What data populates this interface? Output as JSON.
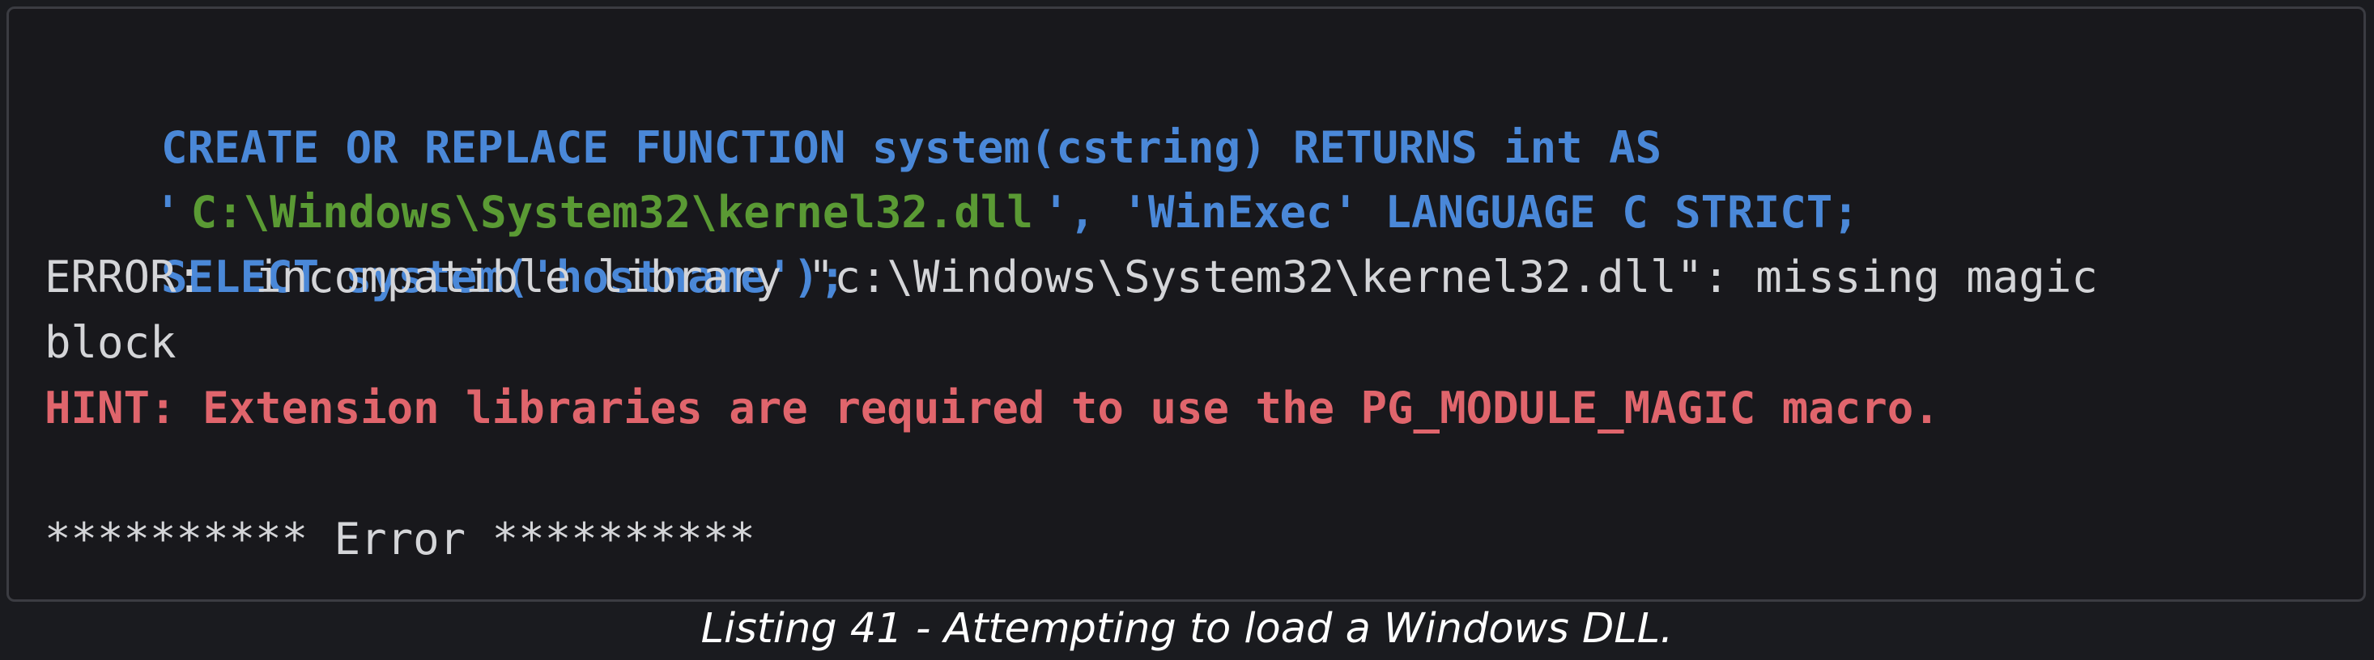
{
  "listing": {
    "sql": {
      "line1": "CREATE OR REPLACE FUNCTION system(cstring) RETURNS int AS",
      "line2_quote_open": "'",
      "line2_path": "C:\\Windows\\System32\\kernel32.dll",
      "line2_rest": "', 'WinExec' LANGUAGE C STRICT;",
      "line3": "SELECT system('hostname');"
    },
    "output": {
      "error_line1": "ERROR:  incompatible library \"c:\\Windows\\System32\\kernel32.dll\": missing magic",
      "error_line2": "block",
      "hint": "HINT: Extension libraries are required to use the PG_MODULE_MAGIC macro.",
      "banner": "********** Error **********"
    },
    "colors": {
      "keyword": "#4a88d8",
      "string": "#5a9a34",
      "plain": "#d4d5d8",
      "hint": "#e0656c",
      "background": "#18181c",
      "border": "#3b3c42"
    }
  },
  "caption": "Listing 41 - Attempting to load a Windows DLL."
}
